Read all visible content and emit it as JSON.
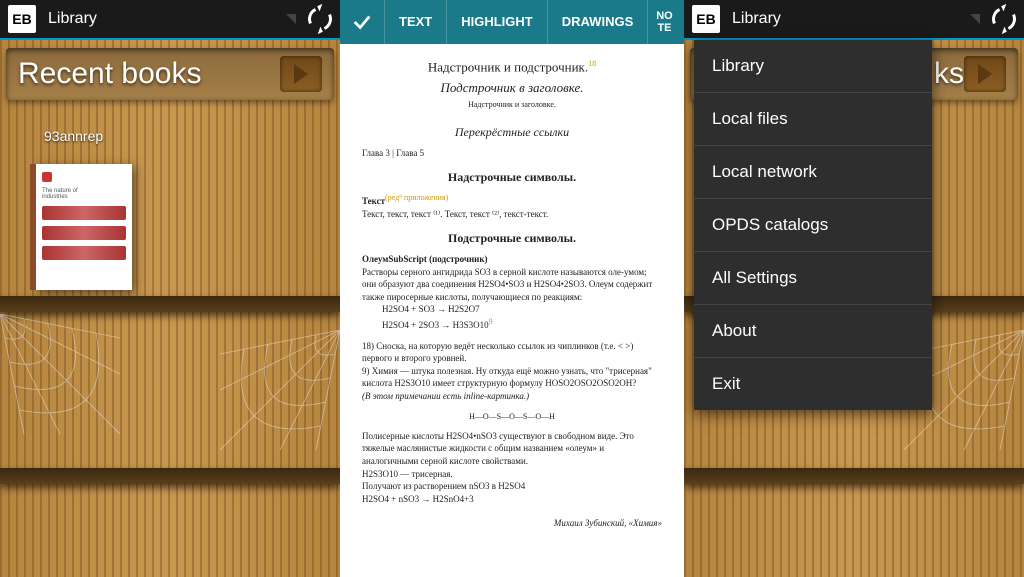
{
  "left": {
    "title": "Library",
    "banner": "Recent books",
    "book_label": "93annrep",
    "logo": "EB"
  },
  "mid": {
    "tabs": {
      "text": "TEXT",
      "highlight": "HIGHLIGHT",
      "drawings": "DRAWINGS",
      "note": "NO\nTE"
    },
    "line1": "Надстрочник и подстрочник.",
    "line2": "Подстрочник в заголовке.",
    "line3": "Надстрочник и заголовке.",
    "cross": "Перекрёстные ссылки",
    "chapters": "Глава 3 | Глава 5",
    "sup_heading": "Надстрочные символы.",
    "text_label": "Текст",
    "text_line": "Текст, текст, текст ⁽¹⁾. Текст, текст ⁽²⁾, текст-текст.",
    "sub_heading": "Подстрочные символы.",
    "oleum": "ОлеумSubScript (подстрочник)",
    "para1": "Растворы серного ангидрида SO3 в серной кислоте называются оле-умом; они образуют два соединения H2SO4•SO3 и H2SO4•2SO3. Олеум содержит также пиросерные кислоты, получающиеся по реакциям:",
    "eq1": "H2SO4 + SO3 → H2S2O7",
    "eq2": "H2SO4 + 2SO3 → H3S3O10",
    "foot18": "18) Сноска, на которую ведёт несколько ссылок из чиплинков (т.е. < >) первого и второго уровней.",
    "foot9": "9) Химия — штука полезная. Ну откуда ещё можно узнать, что \"трисерная\" кислота H2S3O10 имеет структурную формулу HOSO2OSO2OSO2OH?",
    "foot_italic": "(В этом примечании есть inline-картинка.)",
    "final": "Полисерные кислоты H2SO4•nSO3 существуют в свободном виде. Это тяжелые маслянистые жидкости с общим названием «олеум» и аналогичными серной кислоте свойствами.",
    "final_eq1": "H2S3O10 — трисерная.",
    "final_eq2": "Получают из растворением nSO3 в H2SO4",
    "final_eq3": "H2SO4 + nSO3 → H2SnO4+3",
    "author": "Михаил Зубинский, «Химия»"
  },
  "right": {
    "title": "Library",
    "banner_fragment": "ks",
    "logo": "EB",
    "menu": {
      "library": "Library",
      "local_files": "Local files",
      "local_network": "Local network",
      "opds": "OPDS catalogs",
      "all_settings": "All Settings",
      "about": "About",
      "exit": "Exit"
    }
  }
}
